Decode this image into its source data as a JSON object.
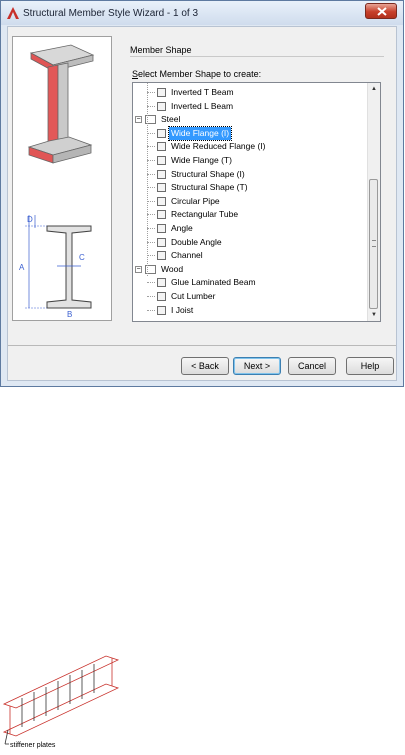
{
  "window": {
    "title": "Structural Member Style Wizard - 1 of 3"
  },
  "group": {
    "label": "Member Shape",
    "select_label_prefix": "S",
    "select_label_rest": "elect Member Shape to create:"
  },
  "tree": {
    "items": [
      {
        "label": "Inverted T Beam",
        "type": "leaf"
      },
      {
        "label": "Inverted L Beam",
        "type": "leaf"
      },
      {
        "label": "Steel",
        "type": "folder"
      },
      {
        "label": "Wide Flange (I)",
        "type": "leaf",
        "selected": true
      },
      {
        "label": "Wide Reduced Flange (I)",
        "type": "leaf"
      },
      {
        "label": "Wide Flange (T)",
        "type": "leaf"
      },
      {
        "label": "Structural Shape (I)",
        "type": "leaf"
      },
      {
        "label": "Structural Shape (T)",
        "type": "leaf"
      },
      {
        "label": "Circular Pipe",
        "type": "leaf"
      },
      {
        "label": "Rectangular Tube",
        "type": "leaf"
      },
      {
        "label": "Angle",
        "type": "leaf"
      },
      {
        "label": "Double Angle",
        "type": "leaf"
      },
      {
        "label": "Channel",
        "type": "leaf"
      },
      {
        "label": "Wood",
        "type": "folder"
      },
      {
        "label": "Glue Laminated Beam",
        "type": "leaf"
      },
      {
        "label": "Cut Lumber",
        "type": "leaf"
      },
      {
        "label": "I Joist",
        "type": "leaf"
      }
    ]
  },
  "diagram": {
    "label_d": "D",
    "label_a": "A",
    "label_c": "C",
    "label_b": "B"
  },
  "buttons": {
    "back": "< Back",
    "next": "Next >",
    "cancel": "Cancel",
    "help": "Help"
  },
  "beam_caption": "stiffener plates",
  "colors": {
    "accent": "#3399ff",
    "flange_red": "#e04848"
  }
}
